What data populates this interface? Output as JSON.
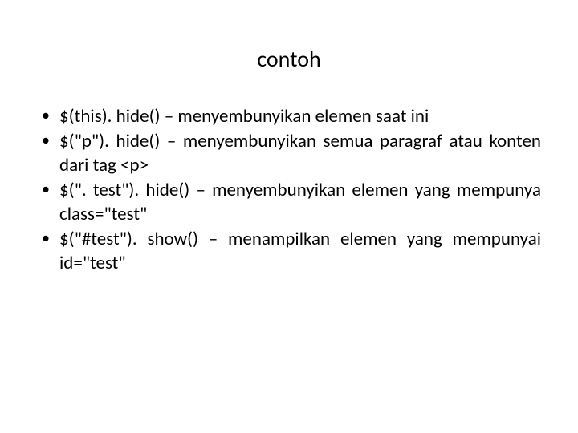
{
  "title": "contoh",
  "bullets": [
    "$(this). hide() – menyembunyikan elemen saat ini",
    "$(\"p\"). hide() – menyembunyikan semua paragraf atau konten dari tag <p>",
    "$(\". test\"). hide() – menyembunyikan elemen yang mempunya class=\"test\"",
    "$(\"#test\"). show() – menampilkan elemen yang mempunyai id=\"test\""
  ]
}
